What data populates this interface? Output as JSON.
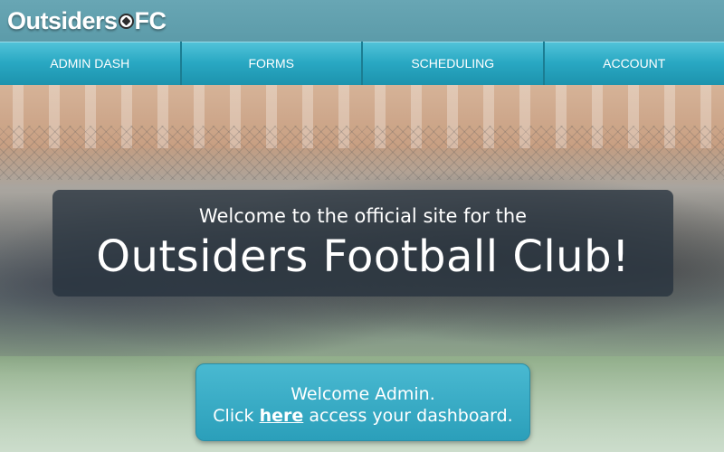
{
  "brand": {
    "logo_text_before": "Outsiders",
    "logo_text_after": "FC"
  },
  "nav": {
    "items": [
      {
        "label": "ADMIN DASH"
      },
      {
        "label": "FORMS"
      },
      {
        "label": "SCHEDULING"
      },
      {
        "label": "ACCOUNT"
      }
    ]
  },
  "hero": {
    "welcome_line1": "Welcome to the official site for the",
    "welcome_line2": "Outsiders Football Club!"
  },
  "admin_box": {
    "line1": "Welcome Admin.",
    "line2_before": "Click",
    "link_text": "here",
    "line2_after": "access your dashboard."
  },
  "colors": {
    "nav_blue": "#29a8c3",
    "topbar": "#68a6b4",
    "overlay": "#26323e"
  }
}
